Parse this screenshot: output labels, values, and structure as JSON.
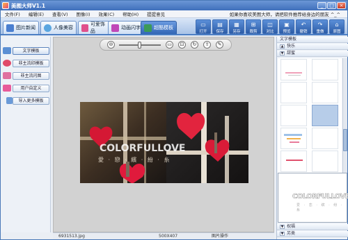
{
  "window": {
    "title": "美图大师V1.1",
    "min": "_",
    "max": "□",
    "close": "×"
  },
  "menu": {
    "items": [
      "文件",
      "编辑",
      "查看",
      "图像",
      "效果",
      "帮助",
      "提提意见"
    ],
    "hotkeys": [
      "(F)",
      "(E)",
      "(V)",
      "(I)",
      "(C)",
      "(H)",
      ""
    ],
    "promo": "如果你喜欢美图大师，请把软件推荐给身边的朋友 ^_^"
  },
  "tabs": [
    {
      "label": "图片新闻",
      "icon": "photo-icon",
      "color": "#4a7fd0"
    },
    {
      "label": "人像美容",
      "icon": "face-icon",
      "color": "#5aa6e0"
    },
    {
      "label": "可爱饰品",
      "icon": "ornament-icon",
      "color": "#e0508c"
    },
    {
      "label": "动画闪字",
      "icon": "sparkle-text-icon",
      "color": "#c048b8"
    },
    {
      "label": "超酷模板",
      "icon": "template-icon",
      "color": "#3c9a58"
    }
  ],
  "toolbar": [
    {
      "label": "打开",
      "icon": "open-icon",
      "glyph": "▭"
    },
    {
      "label": "保存",
      "icon": "save-icon",
      "glyph": "▤"
    },
    {
      "label": "另存",
      "icon": "save-as-icon",
      "glyph": "▦"
    },
    {
      "label": "裁剪",
      "icon": "crop-icon",
      "glyph": "⊞"
    },
    {
      "label": "对比",
      "icon": "compare-icon",
      "glyph": "◫"
    },
    {
      "label": "预览",
      "icon": "preview-icon",
      "glyph": "▣"
    },
    {
      "label": "撤销",
      "icon": "undo-icon",
      "glyph": "↶"
    },
    {
      "label": "重做",
      "icon": "redo-icon",
      "glyph": "↷"
    },
    {
      "label": "原图",
      "icon": "original-icon",
      "glyph": "⌂"
    }
  ],
  "left_panel": [
    {
      "label": "文字模板",
      "icon": "text-template-icon",
      "color": "#5b8fd4"
    },
    {
      "label": "非主流印模板",
      "icon": "stamp-template-icon",
      "color": "#e04a6a"
    },
    {
      "label": "非主流闪图",
      "icon": "flash-template-icon",
      "color": "#e070a0"
    },
    {
      "label": "用户自定义",
      "icon": "custom-template-icon",
      "color": "#e85a9a"
    },
    {
      "label": "导入更多模板",
      "icon": "import-icon",
      "color": "#6a9ad8"
    }
  ],
  "zoom": {
    "level": 0.48
  },
  "photo": {
    "overlay_title": "COLORFULLOVE",
    "overlay_sub": "愛 · 戀 · 繽 · 紛 · 糸"
  },
  "status": {
    "file": "6931513.jpg",
    "size": "500X407",
    "action": "图片操作"
  },
  "right_panel": {
    "header": "文字模板",
    "categories": [
      {
        "label": "快乐",
        "arrow": "▲"
      },
      {
        "label": "甜蜜",
        "arrow": "▼"
      },
      {
        "label": "祝福",
        "arrow": "▼"
      },
      {
        "label": "另类",
        "arrow": "▼"
      }
    ],
    "preview_title": "COLORFULLOVE",
    "preview_sub": "爱 · 恋 · 缤 · 纷 · 糸",
    "scroll_position": 0.76
  },
  "colors": {
    "accent": "#3266b5",
    "title_bar": "#4f7fc8",
    "heart": "#e01a3c"
  }
}
